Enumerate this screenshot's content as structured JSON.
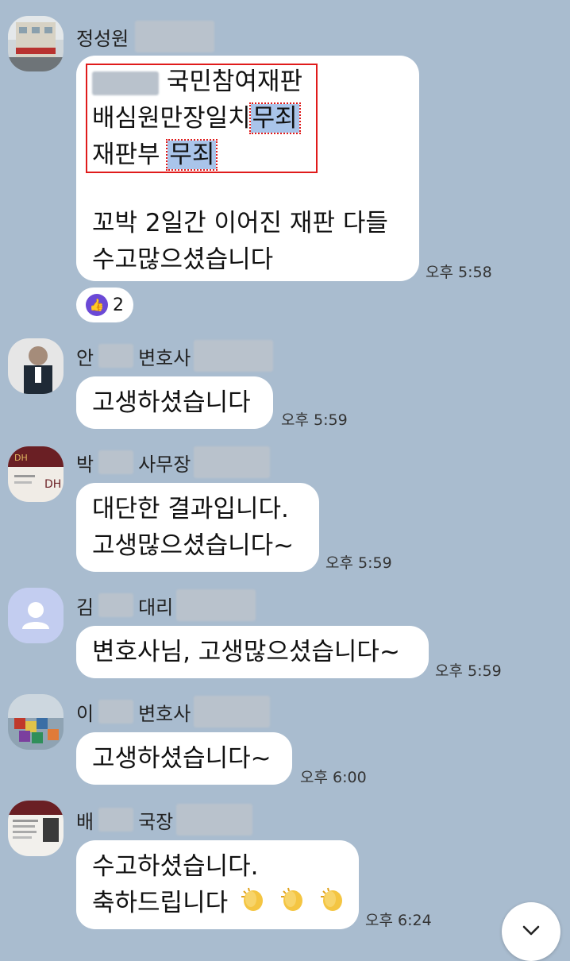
{
  "messages": [
    {
      "name": "정성원",
      "lines_box": [
        "국민참여재판",
        "배심원만장일치",
        "무죄",
        "재판부",
        "무죄"
      ],
      "lines_rest": [
        "꼬박 2일간 이어진 재판 다들",
        "수고많으셨습니다"
      ],
      "time": "오후 5:58",
      "reaction_count": "2"
    },
    {
      "name_prefix": "안",
      "name_suffix": "변호사",
      "lines": [
        "고생하셨습니다"
      ],
      "time": "오후 5:59"
    },
    {
      "name_prefix": "박",
      "name_suffix": "사무장",
      "lines": [
        "대단한 결과입니다.",
        "고생많으셨습니다~"
      ],
      "time": "오후 5:59"
    },
    {
      "name_prefix": "김",
      "name_suffix": "대리",
      "lines": [
        "변호사님, 고생많으셨습니다~"
      ],
      "time": "오후 5:59"
    },
    {
      "name_prefix": "이",
      "name_suffix": "변호사",
      "lines": [
        "고생하셨습니다~"
      ],
      "time": "오후 6:00"
    },
    {
      "name_prefix": "배",
      "name_suffix": "국장",
      "lines": [
        "수고하셨습니다.",
        "축하드립니다"
      ],
      "time": "오후 6:24"
    }
  ],
  "icons": {
    "reaction": "thumbs-up-icon",
    "scroll_down": "chevron-down-icon",
    "clap": "clapping-hands-icon"
  },
  "colors": {
    "background": "#a9bccf",
    "bubble": "#ffffff",
    "highlight": "#a9c4ea",
    "annotation_red": "#e01b1b",
    "reaction_purple": "#6b49d6"
  }
}
